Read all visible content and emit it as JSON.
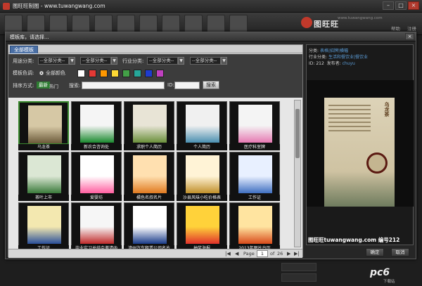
{
  "app": {
    "title": "图旺旺制图 - www.tuwangwang.com",
    "brand": "图旺旺",
    "brand_sub": "作图系统",
    "brand_url": "www.tuwangwang.com",
    "top_links": [
      "帮助",
      "注册"
    ]
  },
  "dialog": {
    "title": "模板库，请选择...",
    "close_glyph": "×",
    "tab": "全部模板",
    "filters": {
      "usage_label": "用途分类:",
      "usage_value": "--全部分类--",
      "usage_value2": "--全部分类--",
      "industry_label": "行业分类:",
      "industry_value": "--全部分类--",
      "industry_value2": "--全部分类--",
      "color_label": "模板色调:",
      "color_all": "全部颜色",
      "sort_label": "排序方式:",
      "sort_new": "最新",
      "sort_hot": "热门",
      "search_label": "搜索:",
      "id_label": "ID:",
      "search_button": "搜索"
    },
    "colors": [
      "#ffffff",
      "#e53935",
      "#ff9800",
      "#fdd835",
      "#43a047",
      "#26a69a",
      "#1e3ccf",
      "#c040c0"
    ],
    "templates": [
      {
        "label": "乌龙茶",
        "style": "tea",
        "selected": true
      },
      {
        "label": "新农合咨询处",
        "style": "sign"
      },
      {
        "label": "求职个人简历",
        "style": "resume"
      },
      {
        "label": "个人简历",
        "style": "resume2"
      },
      {
        "label": "医疗科室牌",
        "style": "med"
      },
      {
        "label": "茶叶上市",
        "style": "teaposter"
      },
      {
        "label": "爱婴坊",
        "style": "baby"
      },
      {
        "label": "橘色名叔名片",
        "style": "orangecard"
      },
      {
        "label": "沙县风味小吃价格表",
        "style": "menu"
      },
      {
        "label": "工作证",
        "style": "workcard"
      },
      {
        "label": "工作证",
        "style": "workcard2"
      },
      {
        "label": "毕业实习总结会邀请函",
        "style": "invite"
      },
      {
        "label": "漳州汽车租赁公司名片",
        "style": "car"
      },
      {
        "label": "抽奖海报",
        "style": "lottery"
      },
      {
        "label": "2013年图片台历",
        "style": "calendar"
      }
    ],
    "pager": {
      "page_label": "Page",
      "page_value": "1",
      "of_label": "of",
      "total": "26"
    },
    "info": {
      "category_key": "分类:",
      "category_value": "表格|招牌|横幅",
      "industry_key": "行业分类:",
      "industry_value": "生活和餐饮业|餐饮业",
      "id_key": "ID:",
      "id_value": "212",
      "author_key": "发布者:",
      "author_value": "chuyu"
    },
    "preview": {
      "title": "乌龙茶",
      "caption": "图旺旺tuwangwang.com 编号212"
    },
    "ok_button": "确定",
    "cancel_button": "取消"
  },
  "watermark": {
    "text": "pc6",
    "sub": "下载站"
  }
}
